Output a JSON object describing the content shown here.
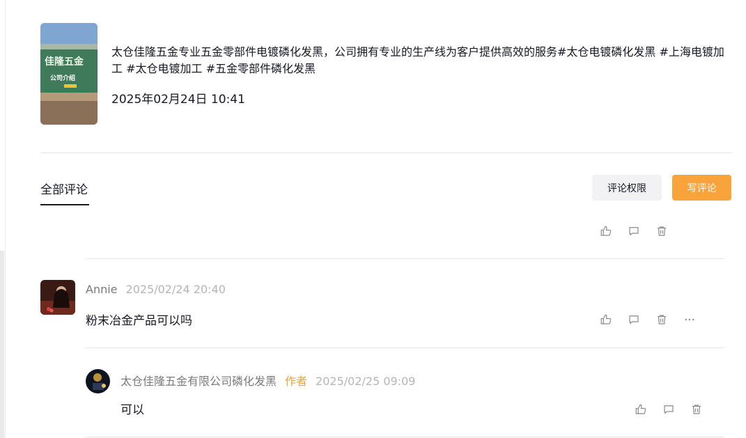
{
  "post": {
    "description": "太仓佳隆五金专业五金零部件电镀磷化发黑，公司拥有专业的生产线为客户提供高效的服务#太仓电镀磷化发黑 #上海电镀加工 #太仓电镀加工 #五金零部件磷化发黑",
    "date": "2025年02月24日 10:41",
    "thumbnail": {
      "logo_text": "佳隆五金",
      "caption": "公司介绍"
    }
  },
  "comments_section": {
    "tab_label": "全部评论",
    "permission_button": "评论权限",
    "write_button": "写评论"
  },
  "comments": [
    {
      "user": "Annie",
      "time": "2025/02/24 20:40",
      "text": "粉末冶金产品可以吗",
      "actions": [
        "like-icon",
        "reply-icon",
        "delete-icon",
        "more-icon"
      ]
    }
  ],
  "replies": [
    {
      "user": "太仓佳隆五金有限公司磷化发黑",
      "badge": "作者",
      "time": "2025/02/25 09:09",
      "text": "可以",
      "actions": [
        "like-icon",
        "reply-icon",
        "delete-icon"
      ]
    }
  ],
  "colors": {
    "accent": "#f9a33b",
    "author_badge": "#e8a33a",
    "muted": "#b5b5b5"
  }
}
